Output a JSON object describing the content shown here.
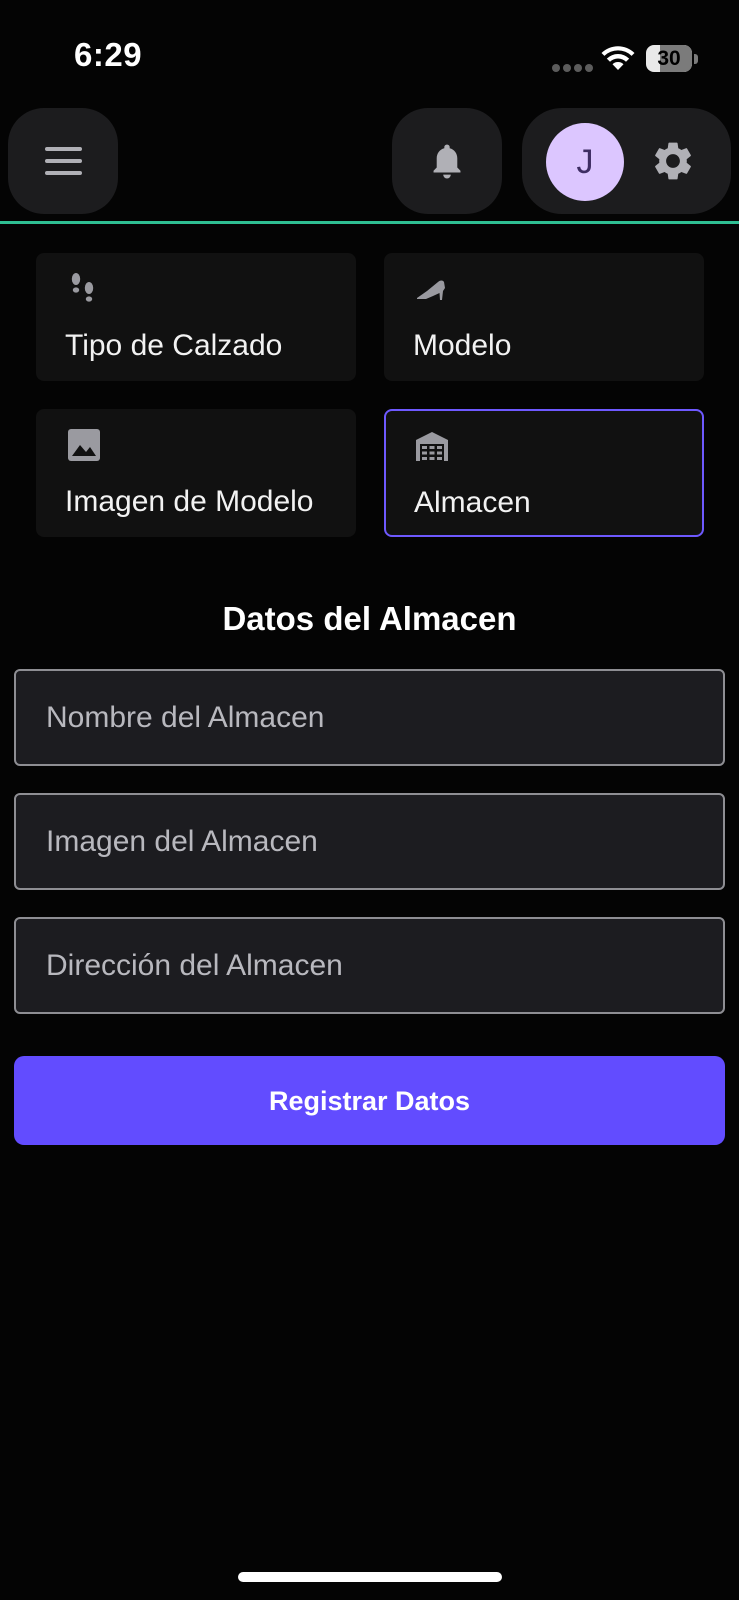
{
  "status_bar": {
    "time": "6:29",
    "battery": "30"
  },
  "app_bar": {
    "avatar_initial": "J",
    "menu_icon": "menu-icon",
    "notification_icon": "bell-icon",
    "settings_icon": "gear-icon"
  },
  "categories": [
    {
      "label": "Tipo de Calzado",
      "icon": "footprints-icon",
      "selected": false
    },
    {
      "label": "Modelo",
      "icon": "high-heel-icon",
      "selected": false
    },
    {
      "label": "Imagen de Modelo",
      "icon": "image-icon",
      "selected": false
    },
    {
      "label": "Almacen",
      "icon": "warehouse-icon",
      "selected": true
    }
  ],
  "form": {
    "title": "Datos del Almacen",
    "fields": [
      {
        "placeholder": "Nombre del Almacen",
        "value": ""
      },
      {
        "placeholder": "Imagen del Almacen",
        "value": ""
      },
      {
        "placeholder": "Dirección del Almacen",
        "value": ""
      }
    ],
    "submit_label": "Registrar Datos"
  },
  "colors": {
    "background": "#040404",
    "accent": "#624cff",
    "selected_border": "#6e59ff",
    "divider": "#2fbf93",
    "avatar_bg": "#dcc6ff"
  }
}
